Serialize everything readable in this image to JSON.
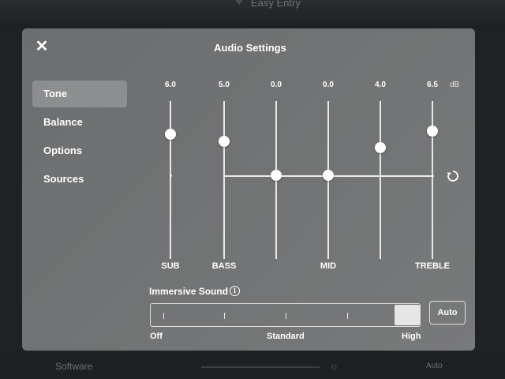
{
  "background": {
    "top_label": "Easy Entry",
    "bottom_left_label": "Software",
    "bottom_right_label": "Auto"
  },
  "panel": {
    "title": "Audio Settings",
    "close_icon": "close-icon"
  },
  "menu": {
    "items": [
      {
        "label": "Tone",
        "active": true
      },
      {
        "label": "Balance",
        "active": false
      },
      {
        "label": "Options",
        "active": false
      },
      {
        "label": "Sources",
        "active": false
      }
    ]
  },
  "equalizer": {
    "unit": "dB",
    "range_db": [
      -12,
      12
    ],
    "bands": [
      {
        "value_label": "6.0",
        "value": 6.0,
        "label": "SUB"
      },
      {
        "value_label": "5.0",
        "value": 5.0,
        "label": "BASS"
      },
      {
        "value_label": "0.0",
        "value": 0.0,
        "label": ""
      },
      {
        "value_label": "0.0",
        "value": 0.0,
        "label": "MID"
      },
      {
        "value_label": "4.0",
        "value": 4.0,
        "label": ""
      },
      {
        "value_label": "6.5",
        "value": 6.5,
        "label": "TREBLE"
      }
    ],
    "reset_icon": "reset-icon"
  },
  "immersive": {
    "label": "Immersive Sound",
    "info_icon": "info-icon",
    "stops": [
      "Off",
      "Standard",
      "High"
    ],
    "selected": "High",
    "level": 1.0,
    "auto_label": "Auto"
  }
}
